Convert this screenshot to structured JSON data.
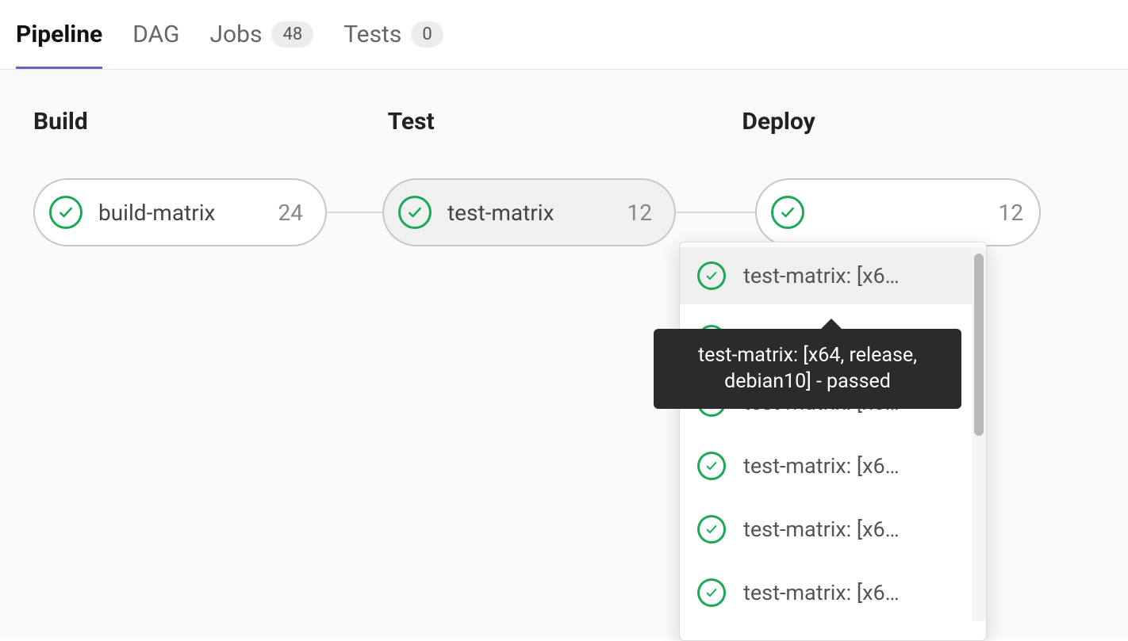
{
  "tabs": {
    "pipeline": "Pipeline",
    "dag": "DAG",
    "jobs_label": "Jobs",
    "jobs_count": "48",
    "tests_label": "Tests",
    "tests_count": "0"
  },
  "stages": {
    "build": "Build",
    "test": "Test",
    "deploy": "Deploy"
  },
  "jobs": {
    "build_matrix": {
      "name": "build-matrix",
      "count": "24"
    },
    "test_matrix": {
      "name": "test-matrix",
      "count": "12"
    },
    "deploy_count": "12"
  },
  "dropdown": {
    "items": [
      "test-matrix: [x6…",
      "test-matrix: [x6…",
      "test-matrix: [x6…",
      "test-matrix: [x6…",
      "test-matrix: [x6…",
      "test-matrix: [x6…"
    ]
  },
  "tooltip": "test-matrix: [x64, release, debian10] - passed"
}
